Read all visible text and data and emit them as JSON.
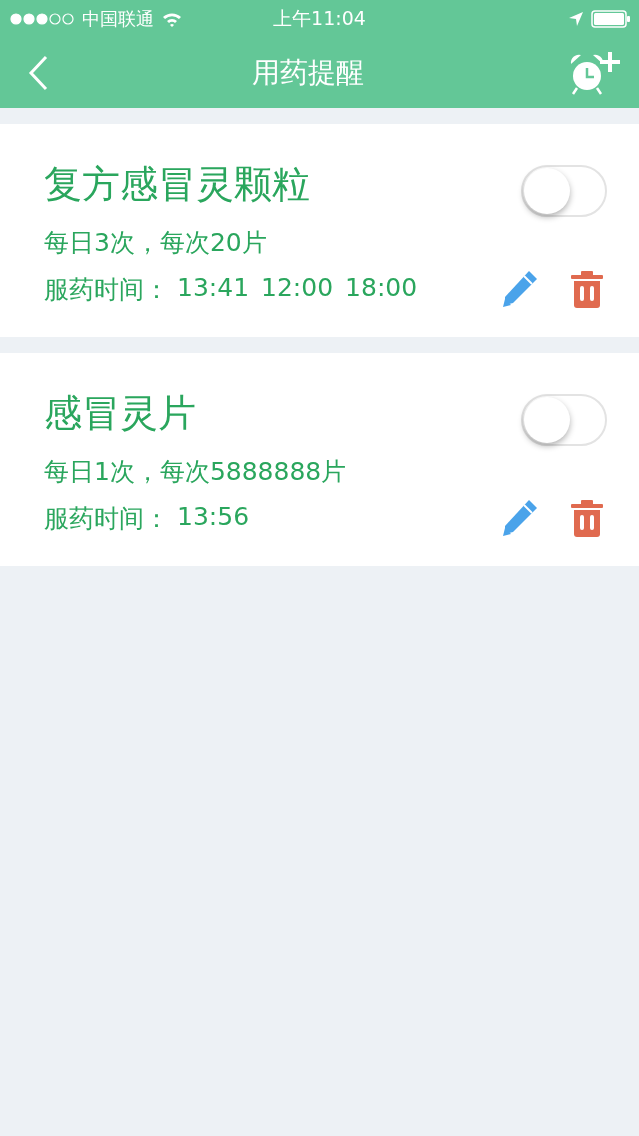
{
  "status_bar": {
    "carrier": "中国联通",
    "time": "上午11:04"
  },
  "header": {
    "title": "用药提醒"
  },
  "reminders": [
    {
      "name": "复方感冒灵颗粒",
      "dosage": "每日3次，每次20片",
      "times_label": "服药时间：",
      "times": [
        "13:41",
        "12:00",
        "18:00"
      ],
      "on": false
    },
    {
      "name": "感冒灵片",
      "dosage": "每日1次，每次5888888片",
      "times_label": "服药时间：",
      "times": [
        "13:56"
      ],
      "on": false
    }
  ]
}
